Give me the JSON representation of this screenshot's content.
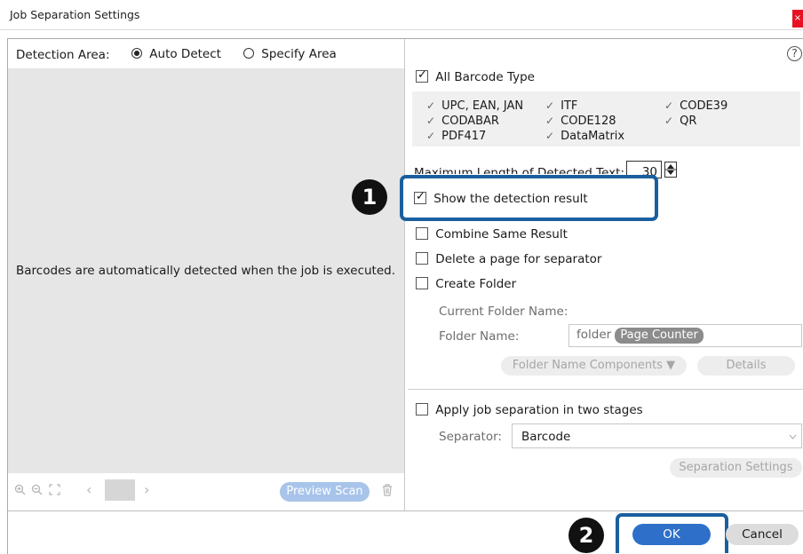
{
  "window": {
    "title": "Job Separation Settings",
    "close_glyph": "×"
  },
  "detection_area": {
    "label": "Detection Area:",
    "options": [
      {
        "label": "Auto Detect",
        "selected": true
      },
      {
        "label": "Specify Area",
        "selected": false
      }
    ]
  },
  "preview": {
    "message": "Barcodes are automatically detected when the job is executed.",
    "toolbar": {
      "zoom_in_icon": "zoom-in-icon",
      "zoom_out_icon": "zoom-out-icon",
      "fit_icon": "fit-page-icon",
      "prev_glyph": "‹",
      "next_glyph": "›",
      "preview_scan_label": "Preview Scan",
      "trash_icon": "trash-icon"
    }
  },
  "help_icon": {
    "glyph": "?",
    "name": "help-icon"
  },
  "barcode": {
    "all_label": "All Barcode Type",
    "all_checked": true,
    "types": [
      {
        "label": "UPC, EAN, JAN",
        "checked": true
      },
      {
        "label": "ITF",
        "checked": true
      },
      {
        "label": "CODE39",
        "checked": true
      },
      {
        "label": "CODABAR",
        "checked": true
      },
      {
        "label": "CODE128",
        "checked": true
      },
      {
        "label": "QR",
        "checked": true
      },
      {
        "label": "PDF417",
        "checked": true
      },
      {
        "label": "DataMatrix",
        "checked": true
      }
    ]
  },
  "max_length": {
    "label": "Maximum Length of Detected Text:",
    "value": "30"
  },
  "options": {
    "show_detection": {
      "label": "Show the detection result",
      "checked": true
    },
    "combine_same": {
      "label": "Combine Same Result",
      "checked": false
    },
    "delete_page": {
      "label": "Delete a page for separator",
      "checked": false
    },
    "create_folder": {
      "label": "Create Folder",
      "checked": false
    }
  },
  "folder": {
    "current_label": "Current Folder Name:",
    "name_label": "Folder Name:",
    "name_prefix": "folder",
    "name_tag": "Page Counter",
    "components_button": "Folder Name Components ▼",
    "details_button": "Details"
  },
  "two_stage": {
    "label": "Apply job separation in two stages",
    "checked": false,
    "separator_label": "Separator:",
    "separator_value": "Barcode",
    "settings_button": "Separation Settings"
  },
  "footer": {
    "ok_label": "OK",
    "cancel_label": "Cancel"
  },
  "callouts": [
    {
      "number": "1"
    },
    {
      "number": "2"
    }
  ],
  "colors": {
    "ok_blue": "#2e70c9",
    "callout_blue": "#1a5f9e",
    "preview_grey": "#e6e6e6",
    "close_red": "#e81123"
  }
}
